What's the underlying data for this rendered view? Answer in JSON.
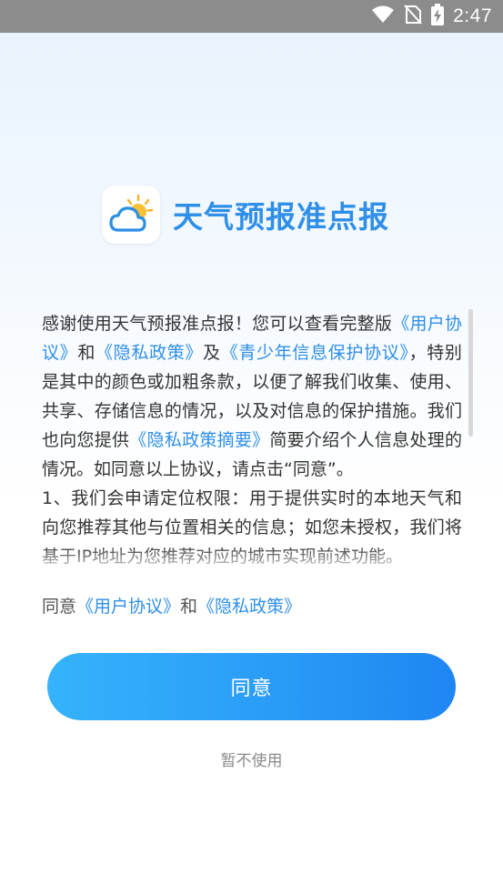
{
  "status_bar": {
    "time": "2:47",
    "icons": [
      "wifi-icon",
      "no-sim-icon",
      "battery-charging-icon"
    ]
  },
  "app": {
    "name": "天气预报准点报",
    "icon": "sun-cloud-icon"
  },
  "agreement": {
    "t1": "感谢使用天气预报准点报！您可以查看完整版",
    "link_user": "《用户协议》",
    "t2": "和",
    "link_privacy": "《隐私政策》",
    "t3": "及",
    "link_minor": "《青少年信息保护协议》",
    "t4": "，特别是其中的颜色或加粗条款，以便了解我们收集、使用、共享、存储信息的情况，以及对信息的保护措施。我们也向您提供",
    "link_summary": "《隐私政策摘要》",
    "t5": "简要介绍个人信息处理的情况。如同意以上协议，请点击“同意”。",
    "p2": "1、我们会申请定位权限：用于提供实时的本地天气和向您推荐其他与位置相关的信息；如您未授权，我们将基于IP地址为您推荐对应的城市实现前述功能。"
  },
  "agree_line": {
    "prefix": "同意",
    "link_user": "《用户协议》",
    "and": "和",
    "link_privacy": "《隐私政策》"
  },
  "buttons": {
    "agree": "同意",
    "decline": "暂不使用"
  },
  "colors": {
    "link": "#2f8fe8",
    "button_start": "#35b3fb",
    "button_end": "#1e86f2",
    "status_bar": "#8c8c8c"
  }
}
